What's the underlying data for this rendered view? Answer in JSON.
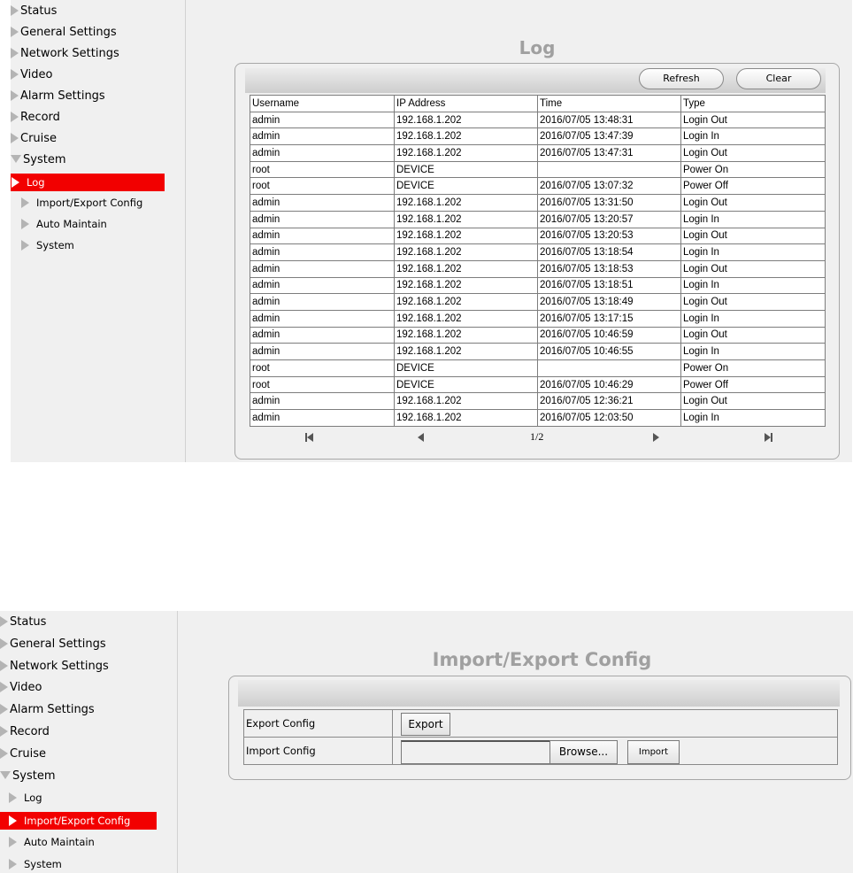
{
  "panel_log": {
    "nav": [
      "Status",
      "General Settings",
      "Network Settings",
      "Video",
      "Alarm Settings",
      "Record",
      "Cruise",
      "System"
    ],
    "subnav": [
      "Log",
      "Import/Export Config",
      "Auto Maintain",
      "System"
    ],
    "title": "Log",
    "buttons": {
      "refresh": "Refresh",
      "clear": "Clear"
    },
    "columns": [
      "Username",
      "IP Address",
      "Time",
      "Type"
    ],
    "rows": [
      [
        "admin",
        "192.168.1.202",
        "2016/07/05 13:48:31",
        "Login Out"
      ],
      [
        "admin",
        "192.168.1.202",
        "2016/07/05 13:47:39",
        "Login In"
      ],
      [
        "admin",
        "192.168.1.202",
        "2016/07/05 13:47:31",
        "Login Out"
      ],
      [
        "root",
        "DEVICE",
        "",
        "Power On"
      ],
      [
        "root",
        "DEVICE",
        "2016/07/05 13:07:32",
        "Power Off"
      ],
      [
        "admin",
        "192.168.1.202",
        "2016/07/05 13:31:50",
        "Login Out"
      ],
      [
        "admin",
        "192.168.1.202",
        "2016/07/05 13:20:57",
        "Login In"
      ],
      [
        "admin",
        "192.168.1.202",
        "2016/07/05 13:20:53",
        "Login Out"
      ],
      [
        "admin",
        "192.168.1.202",
        "2016/07/05 13:18:54",
        "Login In"
      ],
      [
        "admin",
        "192.168.1.202",
        "2016/07/05 13:18:53",
        "Login Out"
      ],
      [
        "admin",
        "192.168.1.202",
        "2016/07/05 13:18:51",
        "Login In"
      ],
      [
        "admin",
        "192.168.1.202",
        "2016/07/05 13:18:49",
        "Login Out"
      ],
      [
        "admin",
        "192.168.1.202",
        "2016/07/05 13:17:15",
        "Login In"
      ],
      [
        "admin",
        "192.168.1.202",
        "2016/07/05 10:46:59",
        "Login Out"
      ],
      [
        "admin",
        "192.168.1.202",
        "2016/07/05 10:46:55",
        "Login In"
      ],
      [
        "root",
        "DEVICE",
        "",
        "Power On"
      ],
      [
        "root",
        "DEVICE",
        "2016/07/05 10:46:29",
        "Power Off"
      ],
      [
        "admin",
        "192.168.1.202",
        "2016/07/05 12:36:21",
        "Login Out"
      ],
      [
        "admin",
        "192.168.1.202",
        "2016/07/05 12:03:50",
        "Login In"
      ]
    ],
    "page": "1/2"
  },
  "panel_config": {
    "nav": [
      "Status",
      "General Settings",
      "Network Settings",
      "Video",
      "Alarm Settings",
      "Record",
      "Cruise",
      "System"
    ],
    "subnav": [
      "Log",
      "Import/Export Config",
      "Auto Maintain",
      "System"
    ],
    "title": "Import/Export Config",
    "export_label": "Export Config",
    "export_button": "Export",
    "import_label": "Import Config",
    "browse_button": "Browse...",
    "import_button": "Import",
    "file_value": ""
  },
  "colors": {
    "active": "#f20000",
    "title": "#a0a0a0",
    "background": "#f0f0f0"
  }
}
